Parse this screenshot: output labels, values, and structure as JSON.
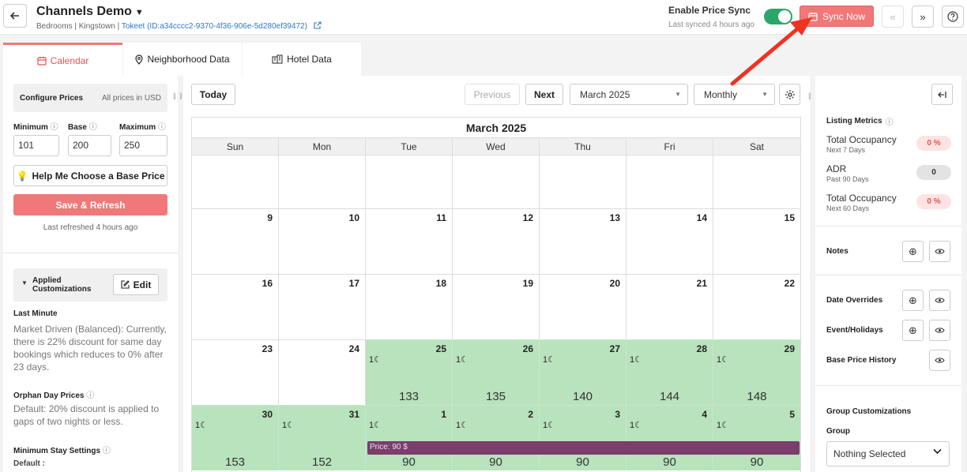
{
  "header": {
    "title": "Channels Demo",
    "subtitle_prefix": "Bedrooms | Kingstown | ",
    "subtitle_link": "Tokeet (ID:a34cccc2-9370-4f36-906e-5d280ef39472)",
    "price_sync_label": "Enable Price Sync",
    "last_synced": "Last synced 4 hours ago",
    "sync_now_label": "Sync Now",
    "price_sync_enabled": true
  },
  "tabs": [
    {
      "label": "Calendar",
      "active": true
    },
    {
      "label": "Neighborhood Data",
      "active": false
    },
    {
      "label": "Hotel Data",
      "active": false
    }
  ],
  "left": {
    "configure_title": "Configure Prices",
    "currency_note": "All prices in USD",
    "min_label": "Minimum",
    "base_label": "Base",
    "max_label": "Maximum",
    "min_value": "101",
    "base_value": "200",
    "max_value": "250",
    "help_label": "Help Me Choose a Base Price",
    "save_label": "Save & Refresh",
    "last_refreshed": "Last refreshed 4 hours ago",
    "applied_title": "Applied Customizations",
    "edit_label": "Edit",
    "last_minute_title": "Last Minute",
    "last_minute_text": "Market Driven (Balanced): Currently, there is 22% discount for same day bookings which reduces to 0% after 23 days.",
    "orphan_title": "Orphan Day Prices",
    "orphan_text": "Default: 20% discount is applied to gaps of two nights or less.",
    "min_stay_title": "Minimum Stay Settings",
    "min_stay_default": "Default :"
  },
  "toolbar": {
    "today_label": "Today",
    "previous_label": "Previous",
    "next_label": "Next",
    "month_value": "March 2025",
    "view_value": "Monthly"
  },
  "calendar": {
    "title": "March 2025",
    "weekdays": [
      "Sun",
      "Mon",
      "Tue",
      "Wed",
      "Thu",
      "Fri",
      "Sat"
    ],
    "weeks": [
      [
        {
          "day": ""
        },
        {
          "day": ""
        },
        {
          "day": ""
        },
        {
          "day": ""
        },
        {
          "day": ""
        },
        {
          "day": ""
        },
        {
          "day": ""
        }
      ],
      [
        {
          "day": "9"
        },
        {
          "day": "10"
        },
        {
          "day": "11"
        },
        {
          "day": "12"
        },
        {
          "day": "13"
        },
        {
          "day": "14"
        },
        {
          "day": "15"
        }
      ],
      [
        {
          "day": "16"
        },
        {
          "day": "17"
        },
        {
          "day": "18"
        },
        {
          "day": "19"
        },
        {
          "day": "20"
        },
        {
          "day": "21"
        },
        {
          "day": "22"
        }
      ],
      [
        {
          "day": "23"
        },
        {
          "day": "24"
        },
        {
          "day": "25",
          "stay": "1☾",
          "price": "133",
          "green": true
        },
        {
          "day": "26",
          "stay": "1☾",
          "price": "135",
          "green": true
        },
        {
          "day": "27",
          "stay": "1☾",
          "price": "140",
          "green": true
        },
        {
          "day": "28",
          "stay": "1☾",
          "price": "144",
          "green": true
        },
        {
          "day": "29",
          "stay": "1☾",
          "price": "148",
          "green": true
        }
      ],
      [
        {
          "day": "30",
          "stay": "1☾",
          "price": "153",
          "green": true
        },
        {
          "day": "31",
          "stay": "1☾",
          "price": "152",
          "green": true
        },
        {
          "day": "1",
          "stay": "1☾",
          "price": "90",
          "green": true
        },
        {
          "day": "2",
          "stay": "1☾",
          "price": "90",
          "green": true
        },
        {
          "day": "3",
          "stay": "1☾",
          "price": "90",
          "green": true
        },
        {
          "day": "4",
          "stay": "1☾",
          "price": "90",
          "green": true
        },
        {
          "day": "5",
          "stay": "1☾",
          "price": "90",
          "green": true
        }
      ]
    ],
    "price_bar_label": "Price: 90 $"
  },
  "right": {
    "listing_metrics_title": "Listing Metrics",
    "metrics": [
      {
        "label": "Total Occupancy",
        "sub": "Next 7 Days",
        "value": "0 %",
        "tone": "red"
      },
      {
        "label": "ADR",
        "sub": "Past 90 Days",
        "value": "0",
        "tone": "gray"
      },
      {
        "label": "Total Occupancy",
        "sub": "Next 60 Days",
        "value": "0 %",
        "tone": "red"
      }
    ],
    "notes_label": "Notes",
    "date_overrides_label": "Date Overrides",
    "events_label": "Event/Holidays",
    "base_history_label": "Base Price History",
    "group_custom_label": "Group Customizations",
    "group_label": "Group",
    "group_value": "Nothing Selected"
  },
  "colors": {
    "accent": "#f07878",
    "toggle_on": "#2aa66a",
    "available_day": "#b8e3bc",
    "price_bar": "#7a3d6c",
    "annotation_arrow": "#ee3322"
  }
}
